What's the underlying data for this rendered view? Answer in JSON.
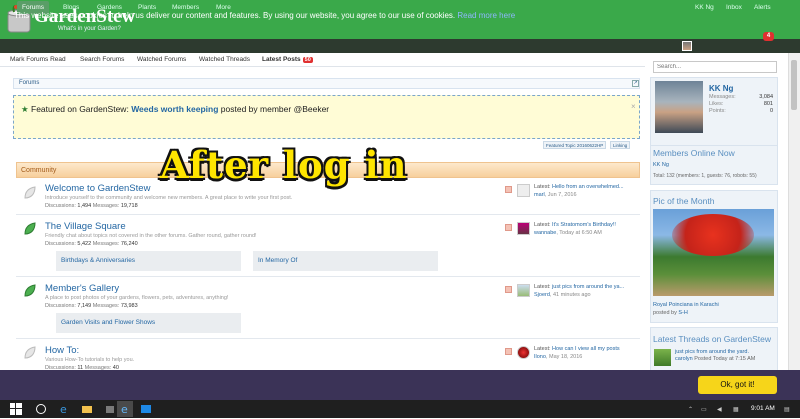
{
  "header": {
    "title": "GardenStew",
    "tagline": "What's in your Garden?"
  },
  "nav": {
    "tabs": [
      "Forums",
      "Blogs",
      "Gardens",
      "Plants",
      "Members",
      "More"
    ],
    "user": "KK Ng",
    "inbox": "Inbox",
    "alerts": "Alerts",
    "alerts_count": "4"
  },
  "subnav": {
    "links": [
      "Mark Forums Read",
      "Search Forums",
      "Watched Forums",
      "Watched Threads",
      "Latest Posts"
    ],
    "latest_count": "50"
  },
  "breadcrumb": "Forums",
  "featured": {
    "prefix": "Featured on GardenStew:",
    "link": "Weeds worth keeping",
    "middle": "posted by member",
    "member": "@Beeker",
    "tag1": "Featured Topic 20160622HP",
    "tag2": "Linking"
  },
  "overlay": "After log in",
  "category": "Community",
  "forums": [
    {
      "title": "Welcome to GardenStew",
      "desc": "Introduce yourself to the community and welcome new members. A great place to write your first post.",
      "disc_label": "Discussions:",
      "disc": "1,494",
      "msg_label": "Messages:",
      "msg": "19,718",
      "latest_label": "Latest:",
      "latest": "Hello from an overwhelmed...",
      "by": "marl",
      "when": "Jun 7, 2016"
    },
    {
      "title": "The Village Square",
      "desc": "Friendly chat about topics not covered in the other forums. Gather round, gather round!",
      "disc_label": "Discussions:",
      "disc": "5,422",
      "msg_label": "Messages:",
      "msg": "76,240",
      "latest_label": "Latest:",
      "latest": "It's Stratomom's Birthday!!",
      "by": "wannabe",
      "when": "Today at 6:50 AM"
    },
    {
      "title": "Member's Gallery",
      "desc": "A place to post photos of your gardens, flowers, pets, adventures, anything!",
      "disc_label": "Discussions:",
      "disc": "7,149",
      "msg_label": "Messages:",
      "msg": "73,983",
      "latest_label": "Latest:",
      "latest": "just pics from around the ya...",
      "by": "Sjoerd",
      "when": "41 minutes ago"
    },
    {
      "title": "How To:",
      "desc": "Various How-To tutorials to help you.",
      "disc_label": "Discussions:",
      "disc": "11",
      "msg_label": "Messages:",
      "msg": "40",
      "latest_label": "Latest:",
      "latest": "How can I view all my posts",
      "by": "Ilono",
      "when": "May 18, 2016"
    }
  ],
  "subforums": [
    "Birthdays & Anniversaries",
    "In Memory Of",
    "Garden Visits and Flower Shows"
  ],
  "sidebar": {
    "search_placeholder": "Search...",
    "profile_name": "KK Ng",
    "stats": [
      {
        "label": "Messages:",
        "value": "3,084"
      },
      {
        "label": "Likes:",
        "value": "801"
      },
      {
        "label": "Points:",
        "value": "0"
      }
    ],
    "online_title": "Members Online Now",
    "online_member": "KK Ng",
    "online_total": "Total: 132 (members: 1, guests: 76, robots: 55)",
    "pic_title": "Pic of the Month",
    "pic_caption": "Royal Poinciana in Karachi",
    "pic_by": "posted by",
    "pic_author": "S-H",
    "threads_title": "Latest Threads on GardenStew",
    "thread_title": "just pics from around the yard.",
    "thread_by": "carolyn",
    "thread_when": "Posted Today at 7:15 AM"
  },
  "cookie": {
    "text": "This website uses cookies to help us deliver our content and features. By using our website, you agree to our use of cookies.",
    "link": "Read more here",
    "button": "Ok, got it!"
  },
  "taskbar": {
    "time": "9:01 AM"
  }
}
